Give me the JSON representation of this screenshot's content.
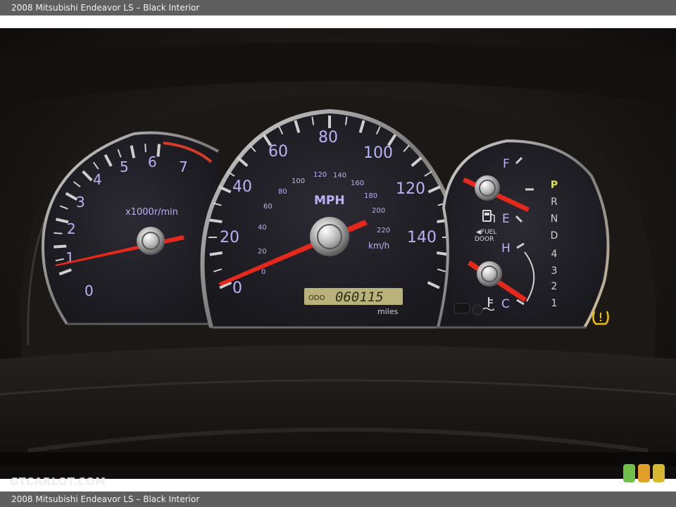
{
  "caption": {
    "top": "2008 Mitsubishi Endeavor LS – Black Interior",
    "bottom": "2008 Mitsubishi Endeavor LS – Black Interior"
  },
  "watermark": "GTCARLOT.COM",
  "tachometer": {
    "numbers": [
      "0",
      "1",
      "2",
      "3",
      "4",
      "5",
      "6",
      "7"
    ],
    "unit": "x1000r/min",
    "needle_reading_rpm_x1000": 0
  },
  "speedometer": {
    "mph_numbers": [
      "0",
      "20",
      "40",
      "60",
      "80",
      "100",
      "120",
      "140"
    ],
    "kmh_numbers": [
      "0",
      "20",
      "40",
      "60",
      "80",
      "100",
      "120",
      "140",
      "160",
      "180",
      "200",
      "220"
    ],
    "unit_mph": "MPH",
    "unit_kmh": "km/h",
    "needle_reading_mph": 0
  },
  "odometer": {
    "prefix": "ODO",
    "value": "060115",
    "unit": "miles"
  },
  "fuel_gauge": {
    "full": "F",
    "empty": "E",
    "door_label": [
      "◀FUEL",
      "DOOR"
    ]
  },
  "temp_gauge": {
    "hot": "H",
    "cold": "C"
  },
  "gear_indicator": {
    "gears": [
      "P",
      "R",
      "N",
      "D",
      "4",
      "3",
      "2",
      "1"
    ],
    "active": "P"
  },
  "colors": {
    "dial_numbers": "#b9b4f5",
    "needle": "#e5281c",
    "active_gear": "#dfe84a",
    "tpms_warning": "#f0c000",
    "lcd": "#b9b27a"
  },
  "icons": [
    "fuel-pump-icon",
    "coolant-temp-icon",
    "tpms-warning-icon",
    "trip-reset-knob-icon"
  ]
}
